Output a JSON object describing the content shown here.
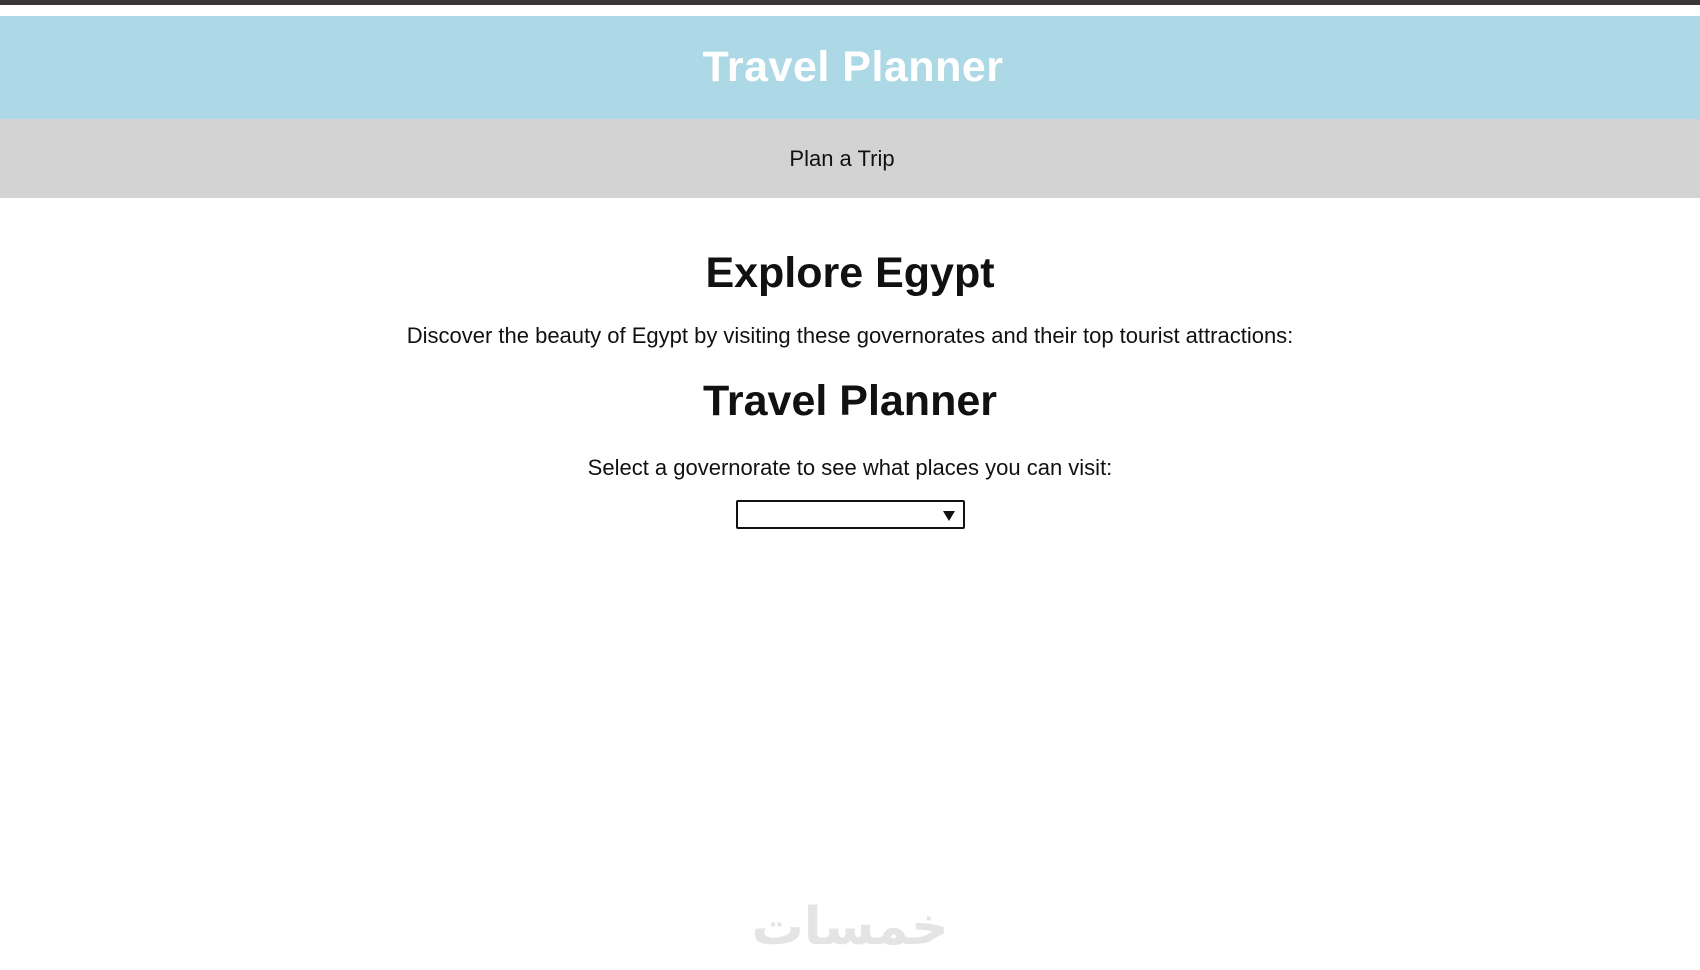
{
  "header": {
    "title": "Travel Planner"
  },
  "nav": {
    "items": [
      {
        "label": "Plan a Trip"
      }
    ]
  },
  "main": {
    "explore_title": "Explore Egypt",
    "explore_description": "Discover the beauty of Egypt by visiting these governorates and their top tourist attractions:",
    "planner_title": "Travel Planner",
    "planner_description": "Select a governorate to see what places you can visit:",
    "governorate_select": {
      "selected_value": ""
    }
  },
  "watermark": {
    "text": "خمسات"
  },
  "colors": {
    "header_bg": "#add8e6",
    "nav_bg": "#d3d3d3",
    "top_strip": "#3a3638"
  }
}
